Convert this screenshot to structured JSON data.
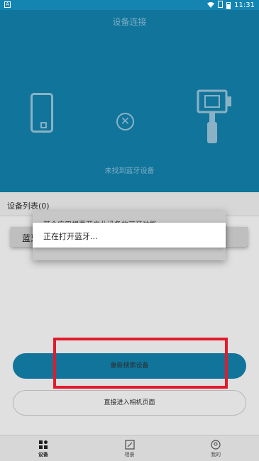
{
  "status_bar": {
    "left_icon": "A",
    "time": "11:31",
    "icons": [
      "wifi-icon",
      "sim-icon",
      "battery-icon"
    ]
  },
  "header": {
    "title": "设备连接",
    "status": "未找到蓝牙设备",
    "icons": [
      "phone-icon",
      "disconnected-icon",
      "gimbal-icon"
    ]
  },
  "device_list": {
    "title": "设备列表(0)"
  },
  "bluetooth_dialog": {
    "title": "蓝牙",
    "hint": "某个应用想要开启此设备的蓝牙功能。"
  },
  "progress_dialog": {
    "message": "正在打开蓝牙..."
  },
  "buttons": {
    "research": "重新搜索设备",
    "enter_camera": "直接进入相机页面"
  },
  "bottom_nav": [
    {
      "label": "设备",
      "icon": "device-icon",
      "active": true
    },
    {
      "label": "相册",
      "icon": "album-icon",
      "active": false
    },
    {
      "label": "我的",
      "icon": "profile-icon",
      "active": false
    }
  ],
  "colors": {
    "primary": "#1484b1",
    "highlight": "#e21b2b"
  }
}
